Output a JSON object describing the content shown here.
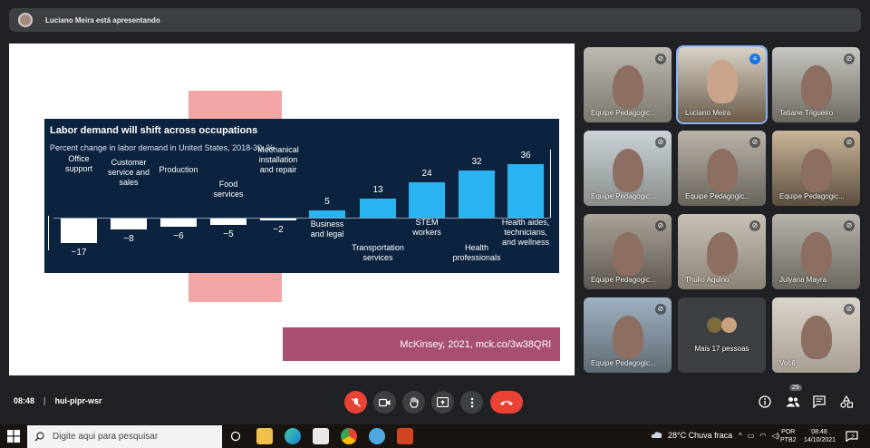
{
  "banner": {
    "presenter": "Luciano Meira está apresentando"
  },
  "slide": {
    "chart_data": {
      "type": "bar",
      "title": "Labor demand will shift across occupations",
      "subtitle": "Percent change in labor demand in United States, 2018-30, %",
      "categories": [
        "Office support",
        "Customer service and sales",
        "Production",
        "Food services",
        "Mechanical installation and repair",
        "Business and legal",
        "Transportation services",
        "STEM workers",
        "Health professionals",
        "Health aides, technicians, and wellness"
      ],
      "values": [
        -17,
        -8,
        -6,
        -5,
        -2,
        5,
        13,
        24,
        32,
        36
      ],
      "value_labels": [
        "−17",
        "−8",
        "−6",
        "−5",
        "−2",
        "5",
        "13",
        "24",
        "32",
        "36"
      ],
      "colors": {
        "negative": "#ffffff",
        "positive": "#29b3f0"
      }
    },
    "label_lines": [
      [
        "Office",
        "support"
      ],
      [
        "Customer",
        "service and",
        "sales"
      ],
      [
        "Production"
      ],
      [
        "Food",
        "services"
      ],
      [
        "Mechanical",
        "installation",
        "and repair"
      ],
      [
        "Business",
        "and legal"
      ],
      [
        "Transportation",
        "services"
      ],
      [
        "STEM",
        "workers"
      ],
      [
        "Health",
        "professionals"
      ],
      [
        "Health aides,",
        "technicians,",
        "and wellness"
      ]
    ],
    "attribution": "McKinsey, 2021, mck.co/3w38QRl"
  },
  "participants": [
    {
      "name": "Equipe Pedagogic...",
      "muted": true
    },
    {
      "name": "Luciano Meira",
      "muted": false
    },
    {
      "name": "Tatiane Trigueiro",
      "muted": true
    },
    {
      "name": "Equipe Pedagogic...",
      "muted": true
    },
    {
      "name": "Equipe Pedagogic...",
      "muted": true
    },
    {
      "name": "Equipe Pedagogic...",
      "muted": true
    },
    {
      "name": "Equipe Pedagogic...",
      "muted": true
    },
    {
      "name": "Thulio Aquino",
      "muted": true
    },
    {
      "name": "Julyana Mayra",
      "muted": true
    },
    {
      "name": "Equipe Pedagogic...",
      "muted": true
    },
    {
      "name": "Mais 17 pessoas",
      "muted": false
    },
    {
      "name": "Você",
      "muted": true
    }
  ],
  "bottom": {
    "time": "08:48",
    "meeting_code": "hui-pipr-wsr",
    "people_count": "29"
  },
  "taskbar": {
    "search_placeholder": "Digite aqui para pesquisar",
    "weather": "28°C  Chuva fraca",
    "lang_top": "POR",
    "lang_bottom": "PTB2",
    "clock_time": "08:48",
    "clock_date": "14/10/2021",
    "notif_count": "2"
  }
}
